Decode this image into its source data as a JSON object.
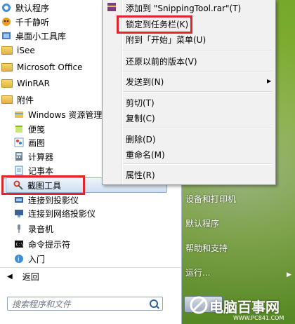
{
  "start_menu": {
    "programs": [
      {
        "label": "默认程序",
        "icon": "default-programs-icon",
        "type": "item"
      },
      {
        "label": "千千静听",
        "icon": "ttplayer-icon",
        "type": "item"
      },
      {
        "label": "桌面小工具库",
        "icon": "gadgets-icon",
        "type": "item"
      },
      {
        "label": "iSee",
        "icon": "folder-icon",
        "type": "folder"
      },
      {
        "label": "Microsoft Office",
        "icon": "folder-icon",
        "type": "folder"
      },
      {
        "label": "WinRAR",
        "icon": "folder-icon",
        "type": "folder"
      },
      {
        "label": "附件",
        "icon": "folder-icon",
        "type": "folder"
      },
      {
        "label": "Windows 资源管理",
        "icon": "explorer-icon",
        "type": "sub"
      },
      {
        "label": "便笺",
        "icon": "sticky-notes-icon",
        "type": "sub"
      },
      {
        "label": "画图",
        "icon": "paint-icon",
        "type": "sub"
      },
      {
        "label": "计算器",
        "icon": "calculator-icon",
        "type": "sub"
      },
      {
        "label": "记事本",
        "icon": "notepad-icon",
        "type": "sub"
      },
      {
        "label": "截图工具",
        "icon": "snipping-tool-icon",
        "type": "sub"
      },
      {
        "label": "连接到投影仪",
        "icon": "projector-icon",
        "type": "sub"
      },
      {
        "label": "连接到网络投影仪",
        "icon": "network-projector-icon",
        "type": "sub"
      },
      {
        "label": "录音机",
        "icon": "sound-recorder-icon",
        "type": "sub"
      },
      {
        "label": "命令提示符",
        "icon": "cmd-icon",
        "type": "sub"
      },
      {
        "label": "入门",
        "icon": "getting-started-icon",
        "type": "sub"
      }
    ],
    "back_label": "返回",
    "search_placeholder": "搜索程序和文件",
    "right_items": [
      "设备和打印机",
      "默认程序",
      "帮助和支持",
      "运行..."
    ]
  },
  "context_menu": {
    "items": [
      {
        "label": "添加到 \"SnippingTool.rar\"(T)"
      },
      {
        "label": "锁定到任务栏(K)"
      },
      {
        "label": "附到「开始」菜单(U)"
      },
      {
        "label": "还原以前的版本(V)"
      },
      {
        "label": "发送到(N)"
      },
      {
        "label": "剪切(T)"
      },
      {
        "label": "复制(C)"
      },
      {
        "label": "删除(D)"
      },
      {
        "label": "重命名(M)"
      },
      {
        "label": "属性(R)"
      }
    ],
    "submenu_arrow": "▶"
  },
  "watermark": {
    "text": "电脑百事网",
    "url_text": "WWW.PC841.COM"
  },
  "colors": {
    "highlight_box": "#e0262b",
    "desktop_green": "#9fce3c"
  }
}
